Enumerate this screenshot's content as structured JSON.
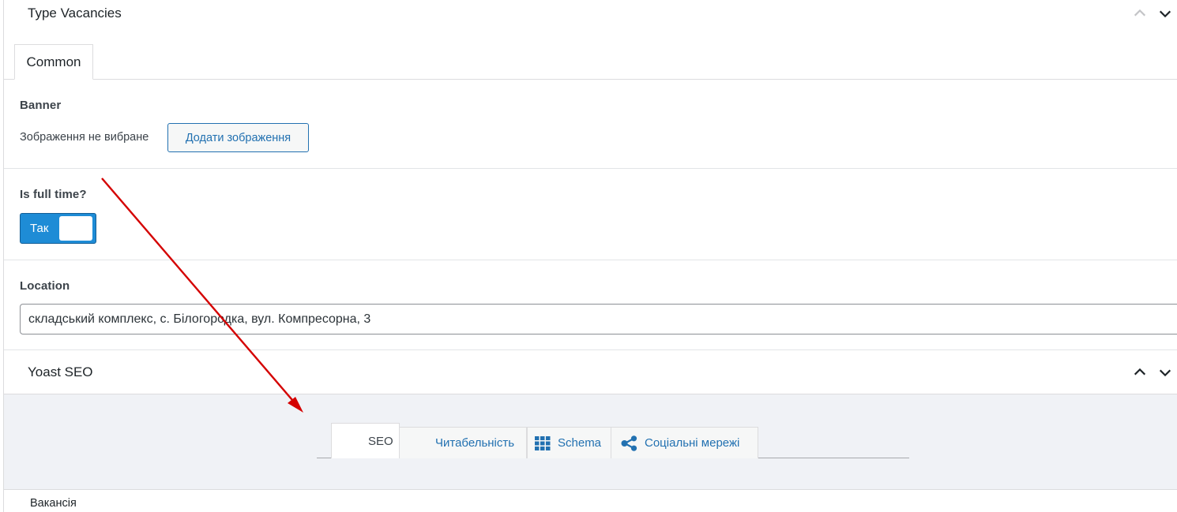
{
  "metabox": {
    "title": "Type Vacancies",
    "tabs": [
      {
        "label": "Common",
        "active": true
      }
    ]
  },
  "fields": {
    "banner": {
      "label": "Banner",
      "status_text": "Зображення не вибране",
      "button_label": "Додати зображення"
    },
    "full_time": {
      "label": "Is full time?",
      "toggle_text": "Так",
      "value": true
    },
    "location": {
      "label": "Location",
      "value": "складський комплекс, с. Білогородка, вул. Компресорна, 3"
    }
  },
  "yoast": {
    "title": "Yoast SEO",
    "tabs": [
      {
        "label": "SEO",
        "icon": "none",
        "active": true
      },
      {
        "label": "Читабельність",
        "icon": "none",
        "active": false
      },
      {
        "label": "Schema",
        "icon": "grid-icon",
        "active": false
      },
      {
        "label": "Соціальні мережі",
        "icon": "share-icon",
        "active": false
      }
    ]
  },
  "footer": {
    "text": "Вакансія"
  },
  "colors": {
    "accent": "#2271b1",
    "toggle_on": "#1e8cd6",
    "annotation_arrow": "#d40000",
    "panel_bg": "#f0f2f6"
  }
}
